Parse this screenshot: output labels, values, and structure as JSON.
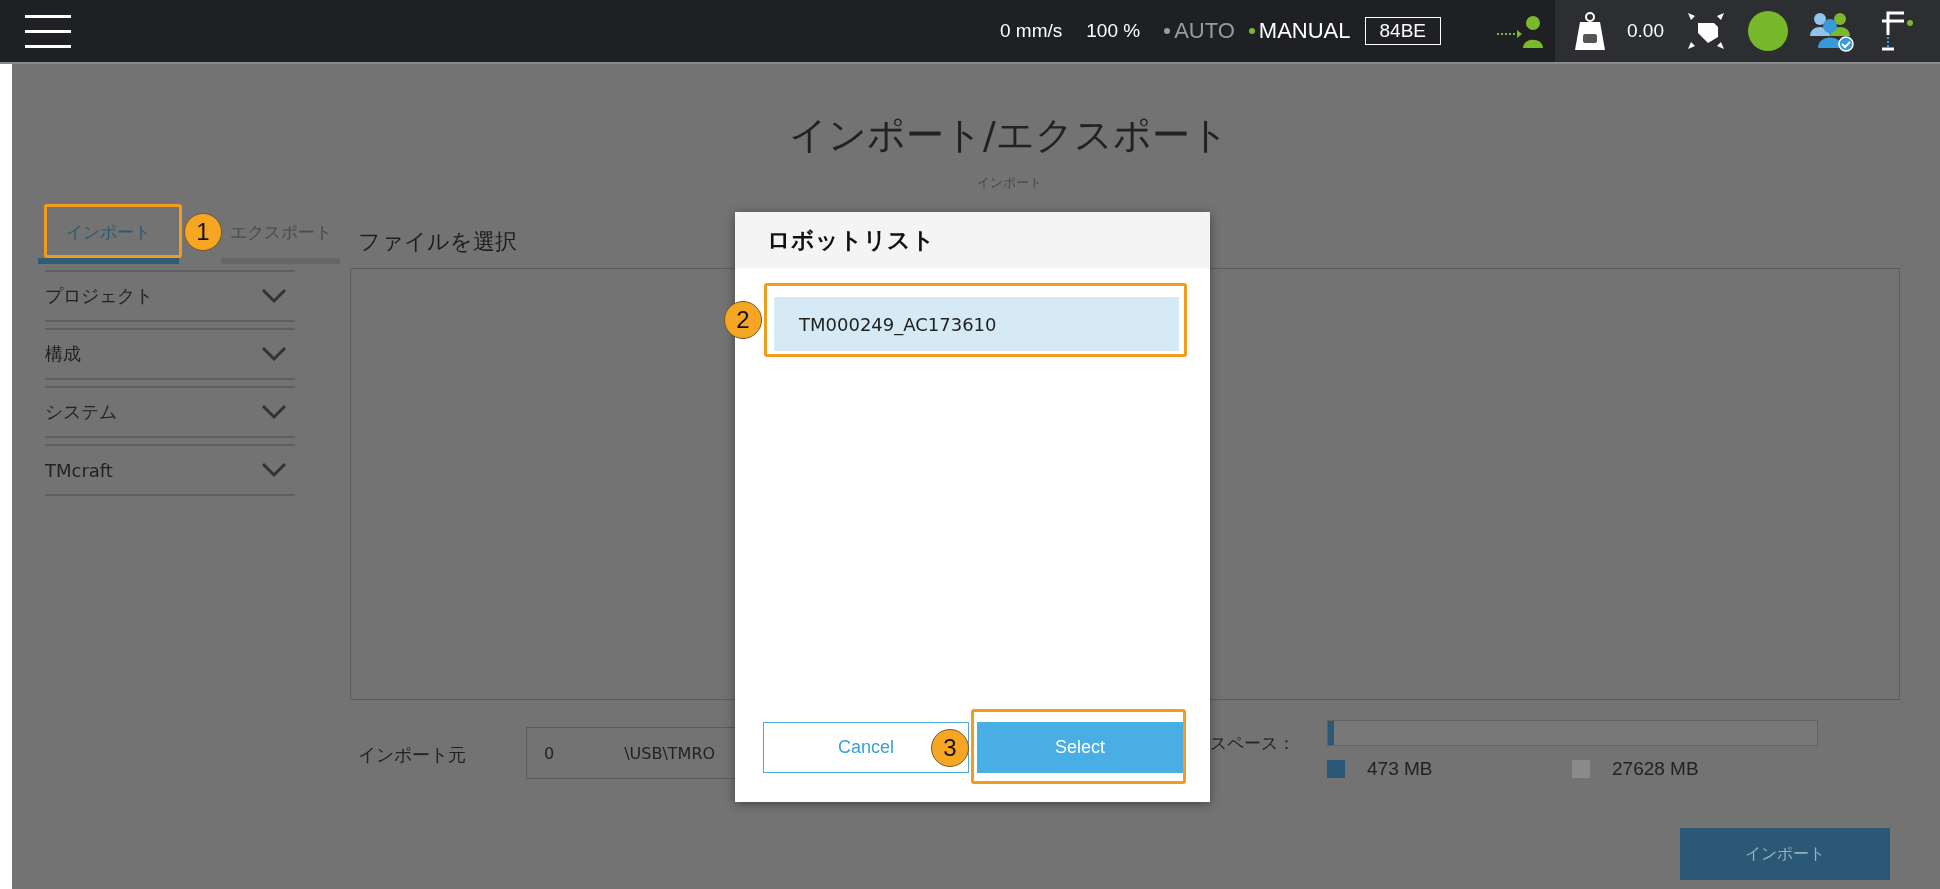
{
  "top_bar": {
    "speed": "0 mm/s",
    "percent": "100 %",
    "modes": [
      {
        "label": "AUTO",
        "selected": false
      },
      {
        "label": "MANUAL",
        "selected": true
      }
    ],
    "code": "84BE",
    "payload": "0.00"
  },
  "page": {
    "title": "インポート/エクスポート",
    "subtitle": "インポート"
  },
  "tabs": [
    {
      "label": "インポート",
      "selected": true
    },
    {
      "label": "エクスポート",
      "selected": false
    }
  ],
  "accordion": [
    {
      "label": "プロジェクト",
      "expanded": false
    },
    {
      "label": "構成",
      "expanded": false
    },
    {
      "label": "システム",
      "expanded": false
    },
    {
      "label": "TMcraft",
      "expanded": false
    }
  ],
  "file_panel": {
    "heading": "ファイルを選択"
  },
  "import_source": {
    "label": "インポート元",
    "value_1": "0",
    "value_2": "\\USB\\TMRO"
  },
  "storage": {
    "label": "スペース：",
    "level": 0.012,
    "used": "473 MB",
    "free": "27628 MB"
  },
  "import_button": "インポート",
  "dialog": {
    "title": "ロボットリスト",
    "robots": [
      {
        "name": "TM000249_AC173610",
        "selected": true
      }
    ],
    "buttons": [
      {
        "label": "Cancel",
        "kind": "secondary"
      },
      {
        "label": "Select",
        "kind": "primary"
      }
    ]
  },
  "callouts": [
    {
      "number": "1"
    },
    {
      "number": "2"
    },
    {
      "number": "3"
    }
  ]
}
